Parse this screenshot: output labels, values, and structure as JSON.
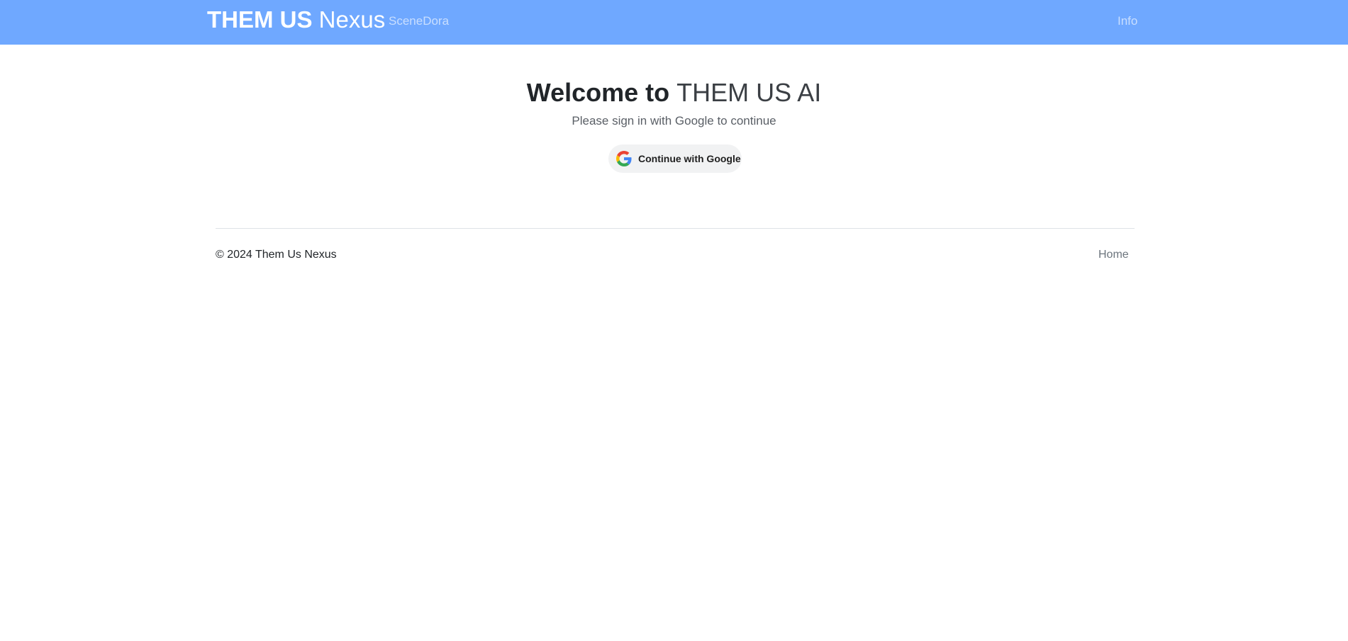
{
  "navbar": {
    "brand_bold": "THEM US",
    "brand_light": "Nexus",
    "links": [
      {
        "label": "SceneDora"
      },
      {
        "label": "Info"
      }
    ],
    "background_color": "#6fa8ff"
  },
  "hero": {
    "title_bold": "Welcome to",
    "title_light": "THEM US AI",
    "subtitle": "Please sign in with Google to continue",
    "google_button": {
      "label": "Continue with Google",
      "icon": "google-g-icon"
    }
  },
  "footer": {
    "copyright": "© 2024 Them Us Nexus",
    "links": [
      {
        "label": "Home"
      }
    ]
  }
}
